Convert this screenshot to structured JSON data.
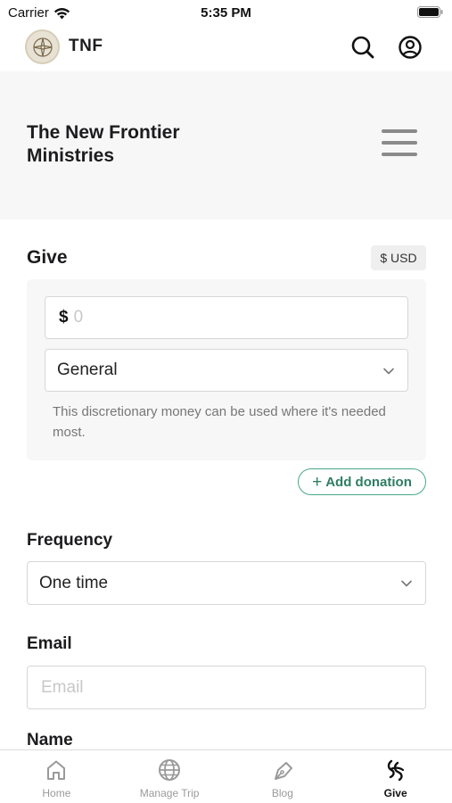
{
  "status_bar": {
    "carrier": "Carrier",
    "time": "5:35 PM"
  },
  "header": {
    "brand": "TNF",
    "logo_icon": "compass-logo-icon",
    "search_icon": "search-icon",
    "account_icon": "account-icon"
  },
  "ministry": {
    "title": "The New Frontier Ministries",
    "menu_icon": "hamburger-menu-icon"
  },
  "give": {
    "heading": "Give",
    "currency": "$ USD",
    "amount": {
      "prefix": "$",
      "value": "",
      "placeholder": "0"
    },
    "fund": {
      "selected": "General",
      "description": "This discretionary money can be used where it's needed most."
    },
    "add_donation_label": "Add donation"
  },
  "frequency": {
    "label": "Frequency",
    "selected": "One time"
  },
  "email": {
    "label": "Email",
    "placeholder": "Email",
    "value": ""
  },
  "name": {
    "label": "Name"
  },
  "tabs": [
    {
      "label": "Home",
      "icon": "home-icon",
      "active": false
    },
    {
      "label": "Manage Trip",
      "icon": "globe-icon",
      "active": false
    },
    {
      "label": "Blog",
      "icon": "pen-icon",
      "active": false
    },
    {
      "label": "Give",
      "icon": "give-icon",
      "active": true
    }
  ],
  "colors": {
    "accent": "#2e7d62",
    "accent_border": "#4aa886",
    "band_bg": "#f7f7f7"
  }
}
